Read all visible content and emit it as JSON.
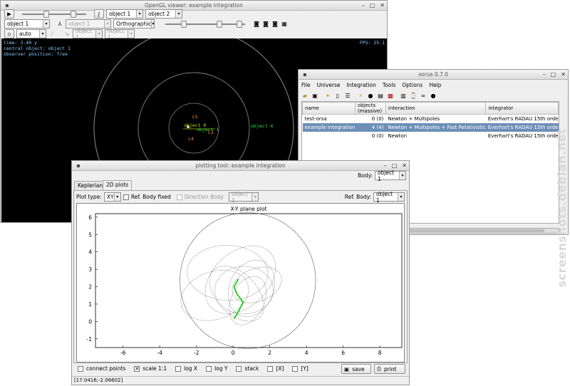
{
  "gl_window": {
    "title": "OpenGL viewer: example integration",
    "object_a": "object 1",
    "object_b": "object 2",
    "center_select": "object 1",
    "disabled_select": "object 1",
    "projection": "Orthographic",
    "auto_select": "auto",
    "small_select_1": "object 1",
    "small_select_2": "object 1",
    "overlay": {
      "time": "time: 3.40   y",
      "central": "central object: object 1",
      "observer": "observer position: free",
      "fps": "FPS: 25.1"
    },
    "scene_labels": [
      "L5",
      "object 0",
      "object 1",
      "L3",
      "L4",
      "object 4"
    ]
  },
  "xorsa_window": {
    "title": "xorsa 0.7.0",
    "menu": [
      "File",
      "Universe",
      "Integration",
      "Tools",
      "Options",
      "Help"
    ],
    "columns": [
      "name",
      "objects (massive)",
      "interaction",
      "integrator"
    ],
    "rows": [
      {
        "name": "test-orsa",
        "objects": "0 (0)",
        "interaction": "Newton + Multipoles",
        "integrator": "Everhart's RADAU 15th orde"
      },
      {
        "name": "example integration",
        "objects": "4 (4)",
        "interaction": "Newton + Multipoles + Fast Relativistic",
        "integrator": "Everhart's RADAU 15th orde"
      },
      {
        "name": "",
        "objects": "0 (0)",
        "interaction": "Newton",
        "integrator": "Everhart's RADAU 15th orde"
      }
    ]
  },
  "plot_window": {
    "title": "plotting tool: example integration",
    "body_label": "Body:",
    "body_value": "object 1",
    "tabs": [
      "Keplerian",
      "2D plots"
    ],
    "plot_type_label": "Plot type:",
    "plot_type_value": "XY",
    "ref_body_fixed": "Ref. Body fixed",
    "direction_body": "Direction Body",
    "direction_body_value": "object 1",
    "ref_body_label": "Ref. Body:",
    "ref_body_value": "object 1",
    "options": [
      {
        "label": "connect points",
        "checked": false
      },
      {
        "label": "scale 1:1",
        "checked": true
      },
      {
        "label": "log X",
        "checked": false
      },
      {
        "label": "log Y",
        "checked": false
      },
      {
        "label": "stack",
        "checked": false
      },
      {
        "label": "[X]",
        "checked": false
      },
      {
        "label": "[Y]",
        "checked": false
      }
    ],
    "save_label": "save",
    "print_label": "print",
    "status": "[17.0416;-2.06602]"
  },
  "chart_data": {
    "type": "scatter",
    "title": "X-Y plane plot",
    "xlim": [
      -7.5,
      9.2
    ],
    "ylim": [
      -1.5,
      6.2
    ],
    "x_ticks": [
      -6,
      -4,
      -2,
      0,
      2,
      4,
      6,
      8
    ],
    "y_ticks": [
      -1,
      0,
      1,
      2,
      3,
      4,
      5,
      6
    ],
    "series": [
      {
        "color": "#333333",
        "kind": "large-circle",
        "center": [
          0.8,
          2.35
        ],
        "radius": 3.7
      },
      {
        "color": "#555555",
        "kind": "orbits",
        "note": ""
      },
      {
        "color": "#00cc00",
        "kind": "path",
        "points": [
          [
            0.3,
            2.45
          ],
          [
            0.05,
            2.0
          ],
          [
            0.2,
            1.6
          ],
          [
            0.55,
            1.1
          ],
          [
            0.25,
            0.5
          ],
          [
            0.05,
            0.15
          ]
        ]
      }
    ]
  },
  "watermark": "screenshots.debian.net"
}
